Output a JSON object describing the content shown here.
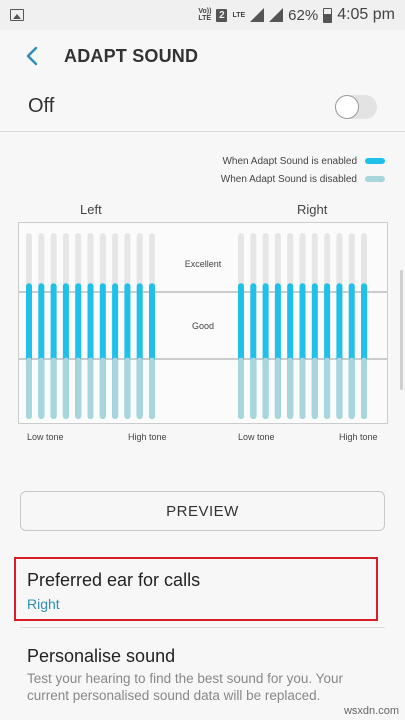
{
  "status_bar": {
    "volte_top": "Vo))",
    "volte_bottom": "LTE",
    "sim_number": "2",
    "lte_label": "LTE",
    "battery": "62%",
    "time": "4:05 pm"
  },
  "header": {
    "title": "ADAPT SOUND"
  },
  "toggle_row": {
    "label": "Off",
    "state": "off"
  },
  "chart_data": {
    "type": "bar",
    "series": [
      {
        "name": "When Adapt Sound is enabled",
        "color": "#1fc1ea"
      },
      {
        "name": "When Adapt Sound is disabled",
        "color": "#a9d5dc"
      }
    ],
    "panels": [
      {
        "label": "Left",
        "bars": 11,
        "enabled_level": 0.73,
        "disabled_level": 0.33
      },
      {
        "label": "Right",
        "bars": 11,
        "enabled_level": 0.73,
        "disabled_level": 0.33
      }
    ],
    "level_labels": [
      "Excellent",
      "Good"
    ],
    "tone_labels": {
      "low": "Low tone",
      "high": "High tone"
    },
    "track_color": "#e6e6e6"
  },
  "preview": {
    "label": "PREVIEW"
  },
  "preferred_ear": {
    "title": "Preferred ear for calls",
    "value": "Right"
  },
  "personalise": {
    "title": "Personalise sound",
    "description": "Test your hearing to find the best sound for you. Your current personalised sound data will be replaced."
  },
  "watermark": "wsxdn.com"
}
